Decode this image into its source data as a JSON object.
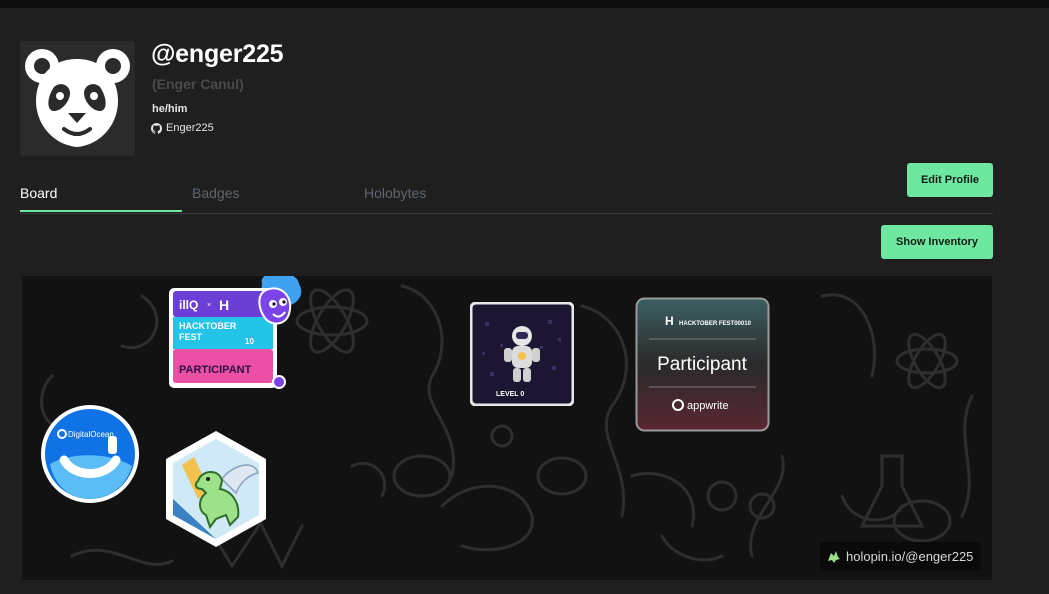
{
  "profile": {
    "username": "@enger225",
    "real_name": "(Enger Canul)",
    "pronouns": "he/him",
    "github": "Enger225",
    "avatar_icon": "panda-avatar"
  },
  "tabs": [
    {
      "label": "Board",
      "active": true
    },
    {
      "label": "Badges",
      "active": false
    },
    {
      "label": "Holobytes",
      "active": false
    }
  ],
  "buttons": {
    "edit_profile": "Edit Profile",
    "show_inventory": "Show Inventory"
  },
  "colors": {
    "accent": "#6ee7a0",
    "background": "#1f1f1f",
    "board_background": "#121212"
  },
  "board": {
    "badges": {
      "hacktoberfest": {
        "brand": "illQ",
        "title_line1": "HACKTOBER",
        "title_line2": "FEST",
        "number": "10",
        "label": "PARTICIPANT"
      },
      "level": {
        "label": "LEVEL 0"
      },
      "appwrite": {
        "header": "HACKTOBER FEST00010",
        "label": "Participant",
        "footer": "appwrite"
      },
      "digitalocean": {
        "label": "DigitalOcean"
      },
      "dino": {
        "label": "dinosaur-badge"
      }
    },
    "watermark": "holopin.io/@enger225"
  }
}
